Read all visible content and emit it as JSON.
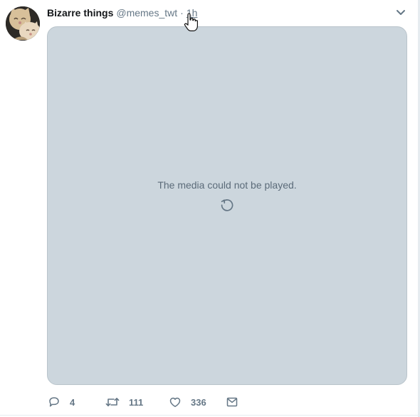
{
  "tweet": {
    "display_name": "Bizarre things",
    "handle": "@memes_twt",
    "separator": "·",
    "timestamp": "1h",
    "avatar_icon": "cat-avatar-icon",
    "menu_icon": "chevron-down-icon"
  },
  "media": {
    "message": "The media could not be played.",
    "retry_icon": "retry-icon",
    "background": "#ccd6dd"
  },
  "actions": {
    "reply_count": "4",
    "retweet_count": "111",
    "like_count": "336",
    "reply_icon": "reply-icon",
    "retweet_icon": "retweet-icon",
    "like_icon": "heart-icon",
    "message_icon": "envelope-icon"
  },
  "colors": {
    "secondary_text": "#657786",
    "primary_text": "#14171a",
    "divider": "#e6ecf0"
  }
}
